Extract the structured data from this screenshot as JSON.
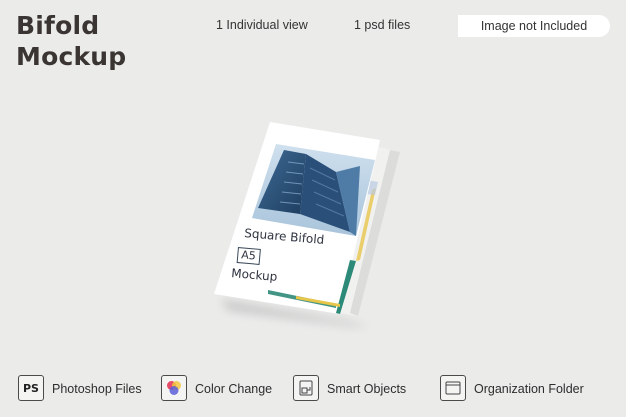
{
  "header": {
    "title_line1": "Bifold",
    "title_line2": "Mockup",
    "individual_view": "1 Individual view",
    "psd_files": "1 psd files",
    "image_notice": "Image not Included"
  },
  "brochure": {
    "cover_line1": "Square Bifold",
    "cover_size": "A5",
    "cover_line2": "Mockup",
    "accent_colors": [
      "#2e8a78",
      "#e7c64a",
      "#6a8ba8"
    ]
  },
  "features": [
    {
      "icon": "photoshop-icon",
      "icon_text": "PS",
      "label": "Photoshop Files"
    },
    {
      "icon": "color-change-icon",
      "label": "Color Change"
    },
    {
      "icon": "smart-objects-icon",
      "label": "Smart Objects"
    },
    {
      "icon": "folder-icon",
      "label": "Organization Folder"
    }
  ]
}
